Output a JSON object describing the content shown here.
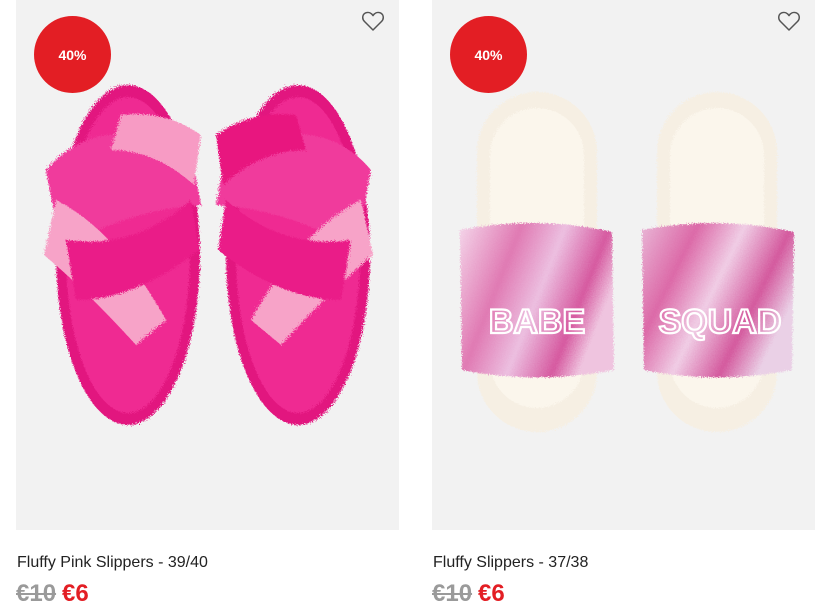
{
  "products": [
    {
      "discount": "40%",
      "name": "Fluffy Pink Slippers - 39/40",
      "old_price": "€10",
      "new_price": "€6",
      "wishlist_icon": "heart-outline-icon"
    },
    {
      "discount": "40%",
      "name": "Fluffy Slippers - 37/38",
      "old_price": "€10",
      "new_price": "€6",
      "print_left": "BABE",
      "print_right": "SQUAD",
      "wishlist_icon": "heart-outline-icon"
    }
  ],
  "colors": {
    "sale_red": "#e31e24",
    "image_bg": "#f2f2f2",
    "old_price_grey": "#9a9a9a"
  }
}
